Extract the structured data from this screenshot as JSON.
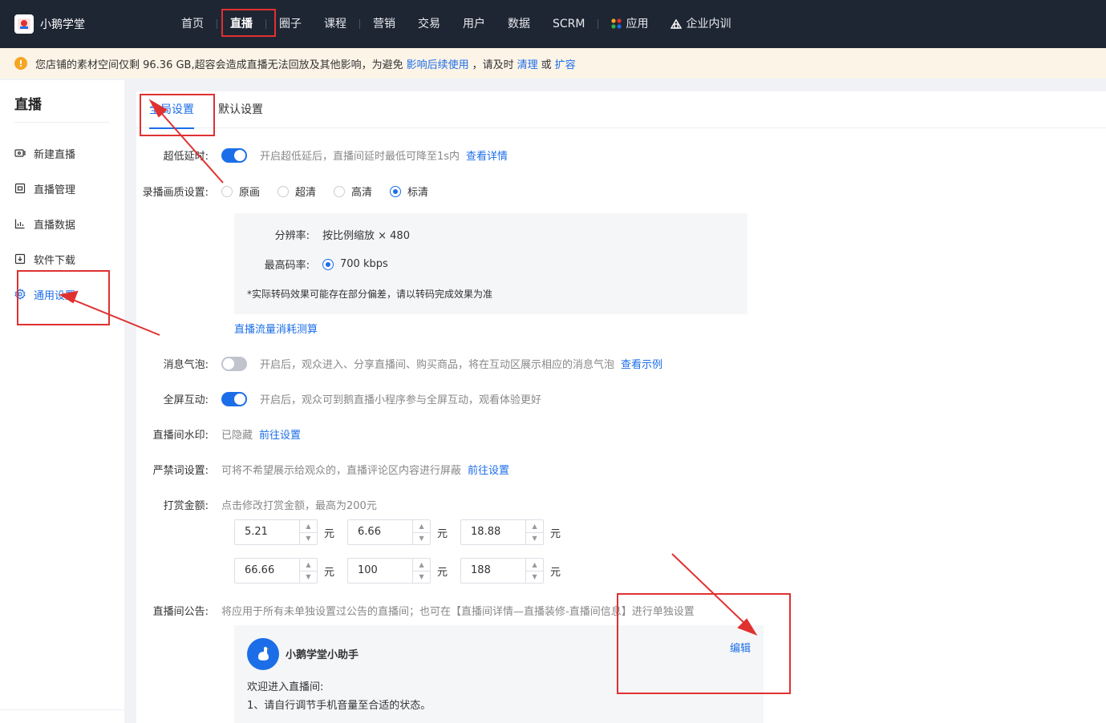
{
  "brand": {
    "name": "小鹅学堂",
    "logo_icon": "goose-logo-icon"
  },
  "nav": {
    "items": [
      {
        "label": "首页",
        "active": false
      },
      {
        "label": "直播",
        "active": true
      },
      {
        "label": "圈子",
        "active": false
      },
      {
        "label": "课程",
        "active": false
      },
      {
        "label": "营销",
        "active": false
      },
      {
        "label": "交易",
        "active": false
      },
      {
        "label": "用户",
        "active": false
      },
      {
        "label": "数据",
        "active": false
      },
      {
        "label": "SCRM",
        "active": false
      },
      {
        "label": "应用",
        "active": false,
        "icon": "apps-icon"
      },
      {
        "label": "企业内训",
        "active": false,
        "icon": "building-icon"
      }
    ]
  },
  "alert": {
    "text_before": "您店铺的素材空间仅剩 96.36 GB,超容会造成直播无法回放及其他影响，为避免",
    "link_impact": "影响后续使用",
    "text_mid": "，请及时",
    "link_clean": "清理",
    "text_or": "或",
    "link_expand": "扩容"
  },
  "sidebar": {
    "title": "直播",
    "items": [
      {
        "label": "新建直播",
        "icon": "new-live-icon",
        "active": false
      },
      {
        "label": "直播管理",
        "icon": "live-manage-icon",
        "active": false
      },
      {
        "label": "直播数据",
        "icon": "live-data-icon",
        "active": false
      },
      {
        "label": "软件下载",
        "icon": "download-icon",
        "active": false
      },
      {
        "label": "通用设置",
        "icon": "settings-icon",
        "active": true
      }
    ]
  },
  "tabs": [
    {
      "label": "全局设置",
      "active": true
    },
    {
      "label": "默认设置",
      "active": false
    }
  ],
  "settings": {
    "low_latency": {
      "label": "超低延时:",
      "on": true,
      "hint": "开启超低延后，直播间延时最低可降至1s内",
      "link": "查看详情"
    },
    "quality": {
      "label": "录播画质设置:",
      "options": [
        "原画",
        "超清",
        "高清",
        "标清"
      ],
      "selected": "标清",
      "resolution_label": "分辨率:",
      "resolution_value": "按比例缩放 × 480",
      "bitrate_label": "最高码率:",
      "bitrate_value": "700 kbps",
      "note": "*实际转码效果可能存在部分偏差，请以转码完成效果为准",
      "traffic_link": "直播流量消耗测算"
    },
    "bubble": {
      "label": "消息气泡:",
      "on": false,
      "hint": "开启后，观众进入、分享直播间、购买商品，将在互动区展示相应的消息气泡",
      "link": "查看示例"
    },
    "fullscreen": {
      "label": "全屏互动:",
      "on": true,
      "hint": "开启后，观众可到鹅直播小程序参与全屏互动，观看体验更好"
    },
    "watermark": {
      "label": "直播间水印:",
      "status": "已隐藏",
      "link": "前往设置"
    },
    "banned_words": {
      "label": "严禁词设置:",
      "hint": "可将不希望展示给观众的，直播评论区内容进行屏蔽",
      "link": "前往设置"
    },
    "reward": {
      "label": "打赏金额:",
      "hint": "点击修改打赏金额，最高为200元",
      "unit": "元",
      "amounts": [
        "5.21",
        "6.66",
        "18.88",
        "66.66",
        "100",
        "188"
      ]
    },
    "notice": {
      "label": "直播间公告:",
      "hint": "将应用于所有未单独设置过公告的直播间；也可在【直播间详情—直播装修-直播间信息】进行单独设置",
      "assistant_name": "小鹅学堂小助手",
      "edit_link": "编辑",
      "line1": "欢迎进入直播间:",
      "line2": "1、请自行调节手机音量至合适的状态。"
    }
  },
  "colors": {
    "nav_bg": "#1f2633",
    "accent": "#1c6ee8",
    "annotation": "#e03131",
    "alert_bg": "#fdf4e8"
  }
}
